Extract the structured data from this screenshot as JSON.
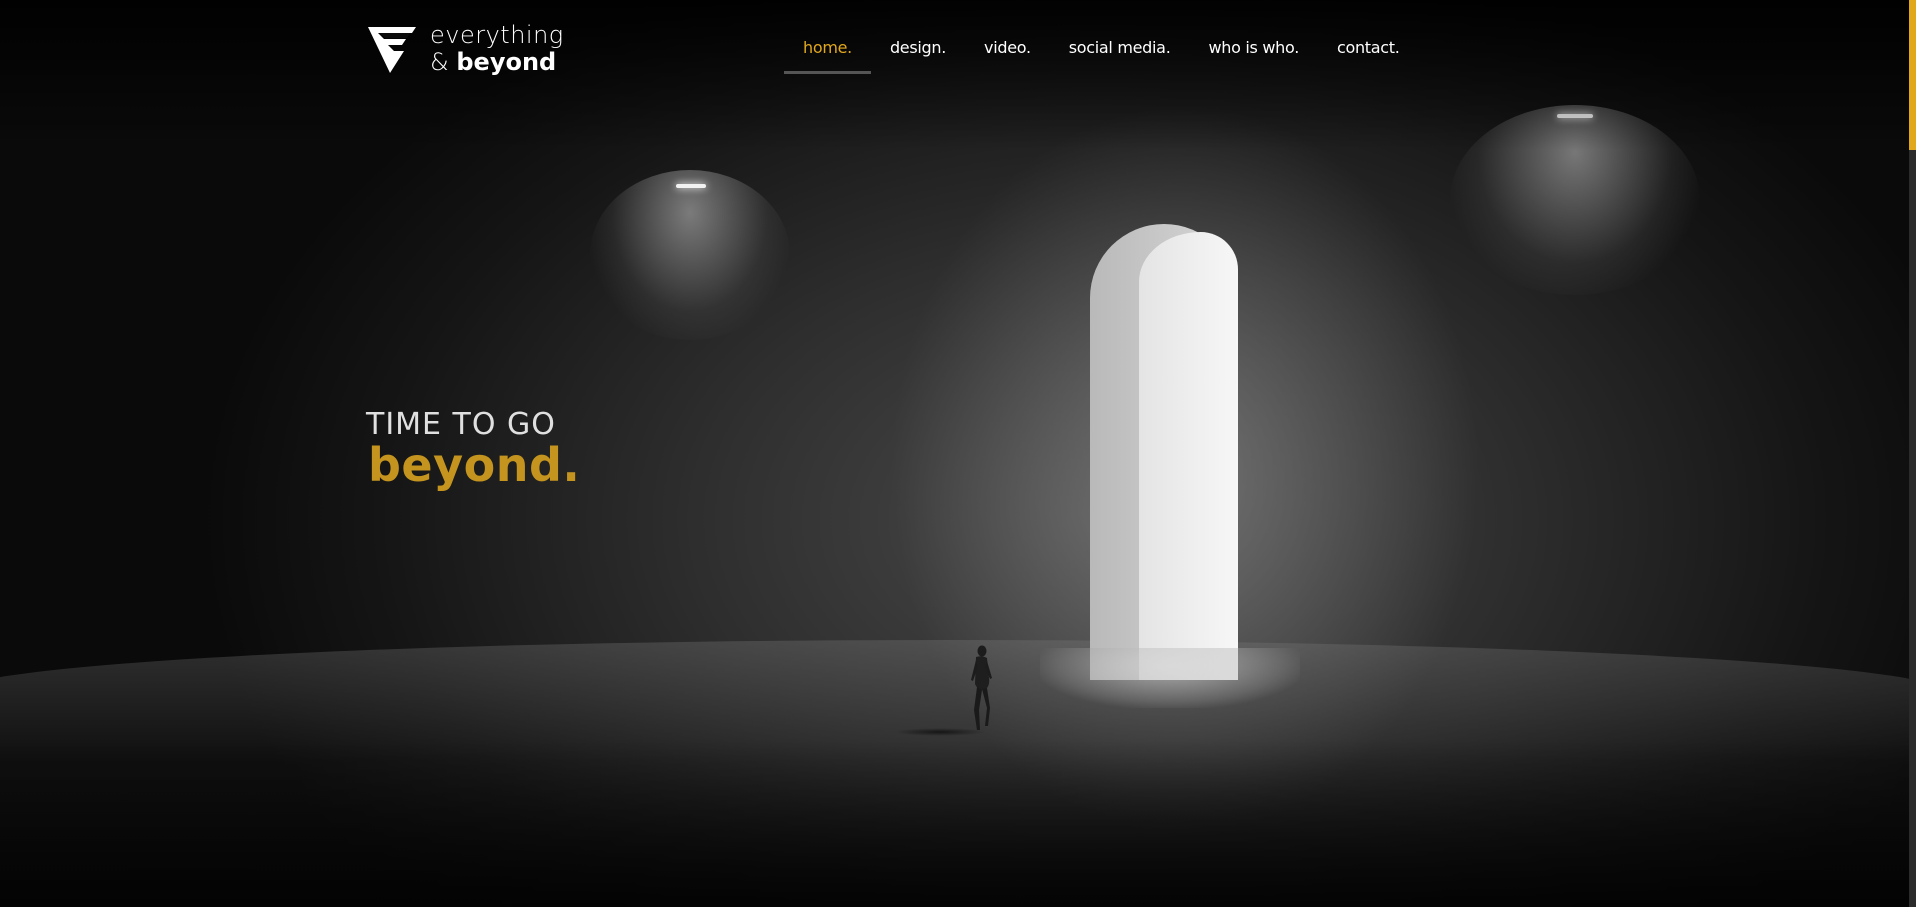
{
  "logo": {
    "line1": "everything",
    "amp": "&",
    "line2": "beyond",
    "mark_icon": "eb-triangle-logo-icon"
  },
  "nav": {
    "items": [
      {
        "label": "home.",
        "active": true
      },
      {
        "label": "design.",
        "active": false
      },
      {
        "label": "video.",
        "active": false
      },
      {
        "label": "social media.",
        "active": false
      },
      {
        "label": "who is who.",
        "active": false
      },
      {
        "label": "contact.",
        "active": false
      }
    ]
  },
  "hero": {
    "tagline_top": "TIME TO GO",
    "tagline_bottom": "beyond."
  },
  "colors": {
    "accent": "#e2a81c",
    "tagline_accent": "#c4941f",
    "background": "#0b0b0b"
  }
}
